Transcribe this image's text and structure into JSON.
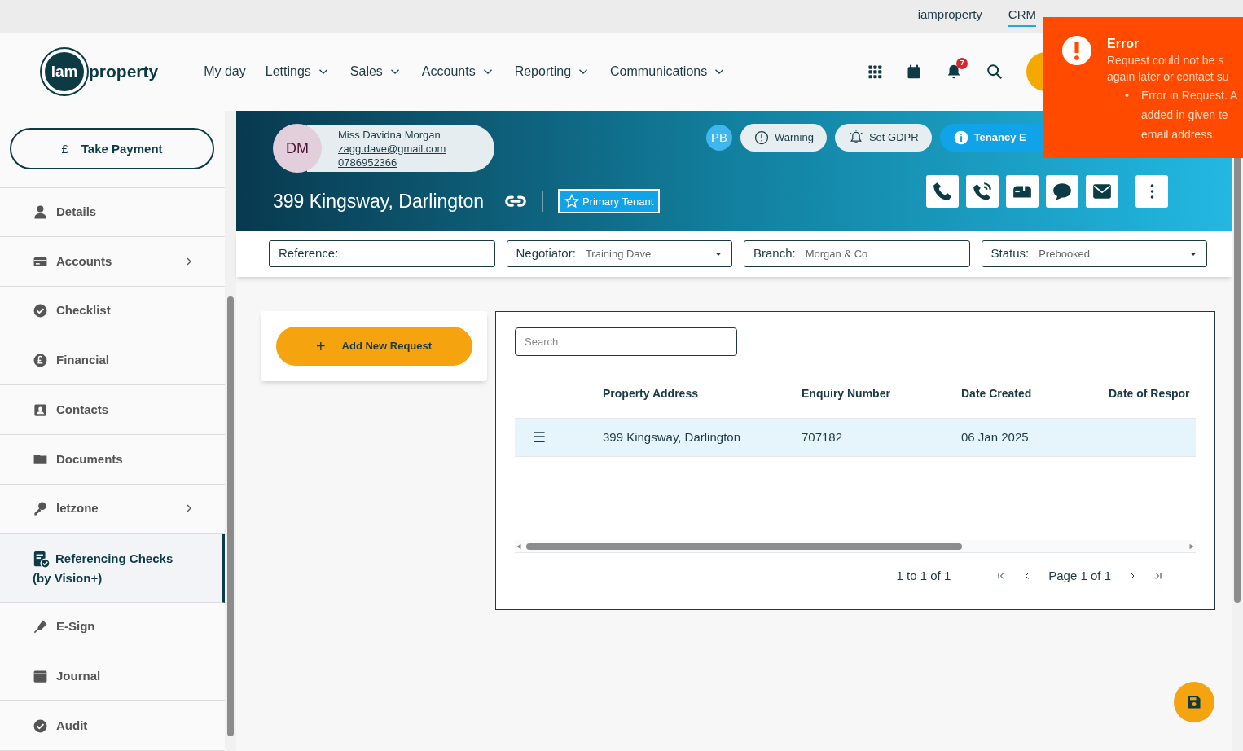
{
  "top_links": [
    {
      "label": "iamproperty",
      "selected": false
    },
    {
      "label": "CRM",
      "selected": true
    }
  ],
  "logo": {
    "mark": "iam",
    "word": "property"
  },
  "nav": [
    {
      "label": "My day",
      "dropdown": false
    },
    {
      "label": "Lettings",
      "dropdown": true
    },
    {
      "label": "Sales",
      "dropdown": true
    },
    {
      "label": "Accounts",
      "dropdown": true
    },
    {
      "label": "Reporting",
      "dropdown": true
    },
    {
      "label": "Communications",
      "dropdown": true
    }
  ],
  "notification_count": "7",
  "sidebar": {
    "payment_button": {
      "icon": "£",
      "label": "Take Payment"
    },
    "items": [
      {
        "label": "Details",
        "kind": "person",
        "submenu": false,
        "selected": false
      },
      {
        "label": "Accounts",
        "kind": "card",
        "submenu": true,
        "selected": false
      },
      {
        "label": "Checklist",
        "kind": "check",
        "submenu": false,
        "selected": false
      },
      {
        "label": "Financial",
        "kind": "pound",
        "submenu": false,
        "selected": false
      },
      {
        "label": "Contacts",
        "kind": "contact",
        "submenu": false,
        "selected": false
      },
      {
        "label": "Documents",
        "kind": "folder",
        "submenu": false,
        "selected": false
      },
      {
        "label": "letzone",
        "kind": "key",
        "submenu": true,
        "selected": false
      },
      {
        "label": "Referencing Checks (by Vision+)",
        "kind": "doccheck",
        "submenu": false,
        "selected": true
      },
      {
        "label": "E-Sign",
        "kind": "pen",
        "submenu": false,
        "selected": false
      },
      {
        "label": "Journal",
        "kind": "journal",
        "submenu": false,
        "selected": false
      },
      {
        "label": "Audit",
        "kind": "check",
        "submenu": false,
        "selected": false
      }
    ]
  },
  "contact": {
    "initials": "DM",
    "name": "Miss Davidna Morgan",
    "email": "zagg.dave@gmail.com",
    "phone": "0786952366"
  },
  "address": "399 Kingsway, Darlington",
  "role_badge": "Primary Tenant",
  "tag_initials": "PB",
  "tags": [
    {
      "label": "Warning",
      "kind": "warning"
    },
    {
      "label": "Set GDPR",
      "kind": "gdpr"
    },
    {
      "label": "Tenancy E",
      "kind": "info"
    }
  ],
  "filters": [
    {
      "label": "Reference:",
      "dropdown": false
    },
    {
      "label": "Negotiator:",
      "value": "Training Dave",
      "dropdown": true
    },
    {
      "label": "Branch:",
      "value": "Morgan & Co",
      "dropdown": false
    },
    {
      "label": "Status:",
      "value": "Prebooked",
      "dropdown": true
    }
  ],
  "add_button": {
    "icon": "+",
    "label": "Add New Request"
  },
  "search": {
    "placeholder": "Search"
  },
  "table": {
    "columns": [
      "Property Address",
      "Enquiry Number",
      "Date Created",
      "Date of Respor"
    ],
    "rows": [
      {
        "menu_icon": "☰",
        "cells": [
          "399 Kingsway, Darlington",
          "707182",
          "06 Jan 2025",
          ""
        ],
        "selected": true
      }
    ]
  },
  "pagination": {
    "summary": "1 to 1 of 1",
    "page": "Page 1 of 1"
  },
  "toast": {
    "title": "Error",
    "lines": [
      "Request could not be s",
      "again later or contact su"
    ],
    "bullet_mark": "•",
    "bullet": [
      "Error in Request. A",
      "added in given te",
      "email address."
    ]
  }
}
